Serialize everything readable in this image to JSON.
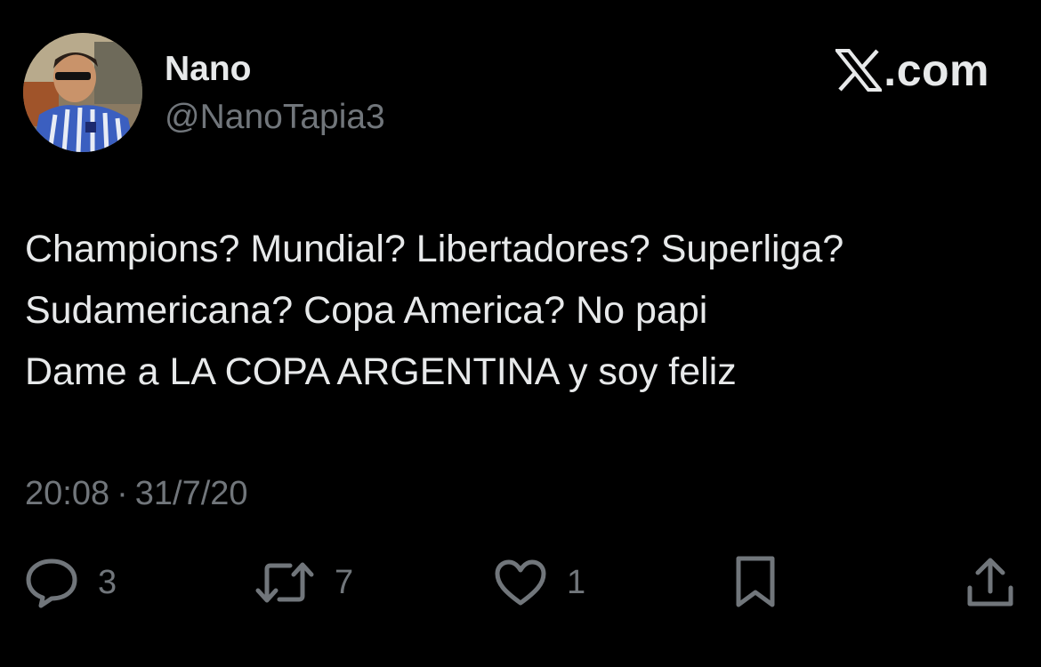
{
  "author": {
    "display_name": "Nano",
    "handle": "@NanoTapia3",
    "avatar_icon": "profile-photo"
  },
  "brand": {
    "text": ".com",
    "logo_icon": "x-logo-icon"
  },
  "tweet": {
    "lines": [
      "Champions? Mundial? Libertadores? Superliga?",
      "Sudamericana? Copa America? No papi",
      "Dame a LA COPA ARGENTINA y soy feliz"
    ],
    "time": "20:08",
    "separator": "·",
    "date": "31/7/20"
  },
  "actions": {
    "replies": "3",
    "retweets": "7",
    "likes": "1"
  },
  "colors": {
    "background": "#000000",
    "primary_text": "#e7e9ea",
    "secondary_text": "#71767b"
  }
}
